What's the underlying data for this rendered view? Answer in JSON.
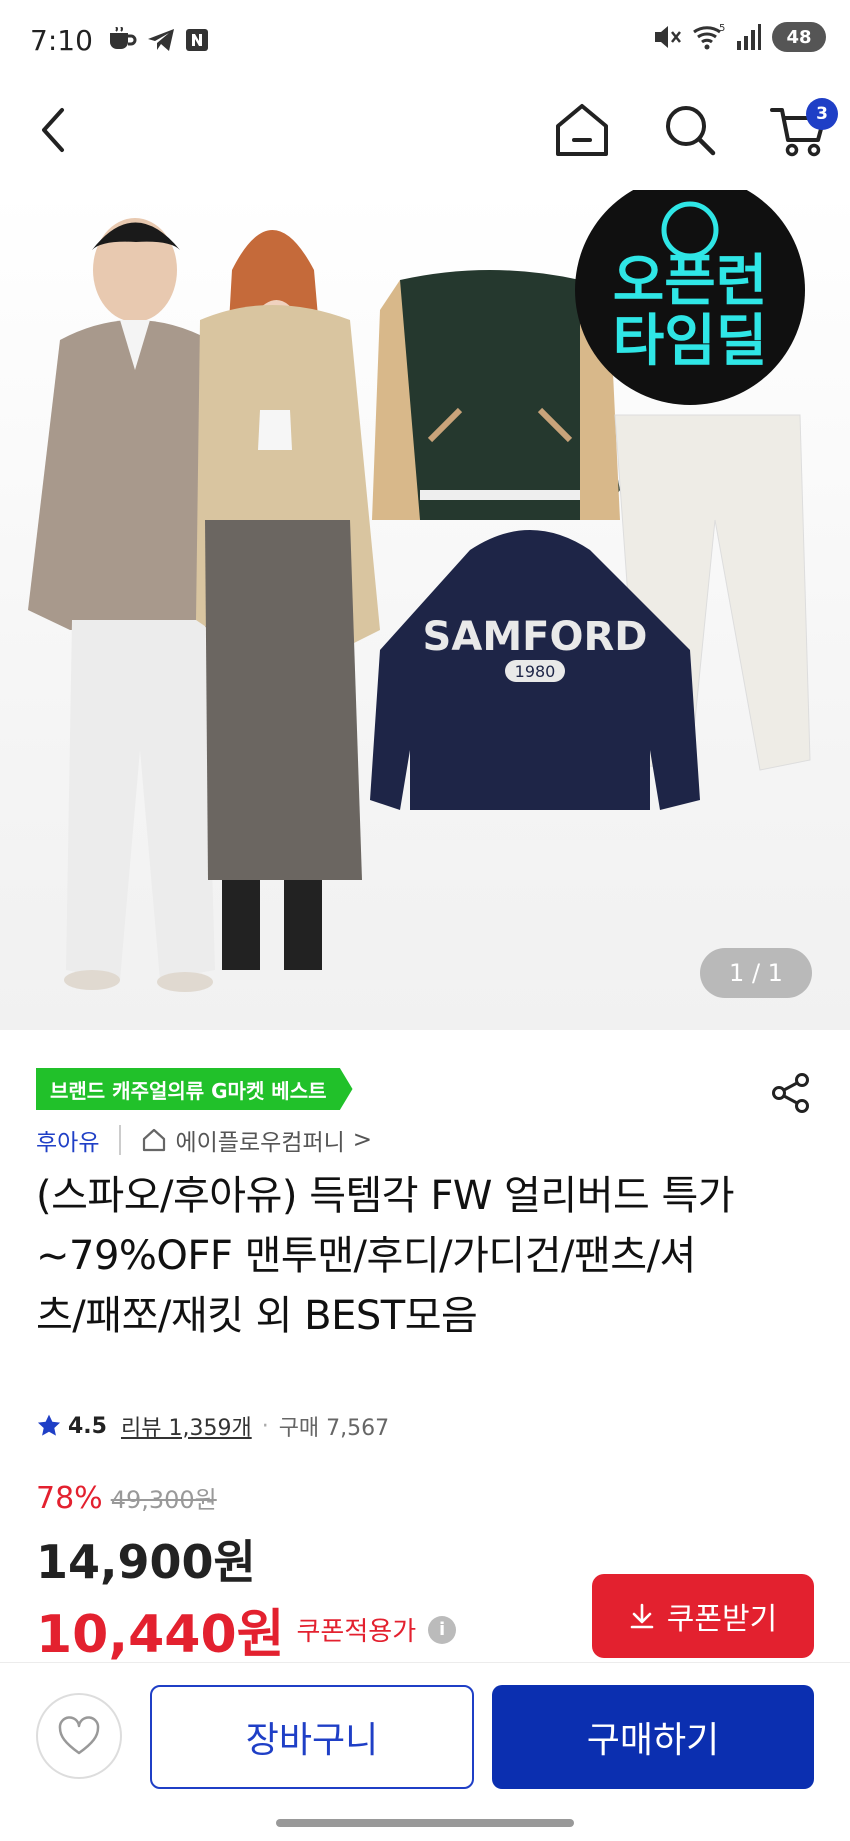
{
  "status_bar": {
    "time": "7:10",
    "left_icons": [
      "coffee-icon",
      "telegram-icon",
      "n-app-icon"
    ],
    "right_icons": [
      "mute-icon",
      "wifi-icon",
      "signal-icon"
    ],
    "wifi_label": "5",
    "battery": "48"
  },
  "nav": {
    "cart_count": "3"
  },
  "hero": {
    "badge_line1": "오픈런",
    "badge_line2": "타임딜",
    "hoodie_text": "SAMFORD",
    "hoodie_sub": "1980",
    "page_indicator": "1 / 1"
  },
  "product": {
    "best_tag": "브랜드 캐주얼의류 G마켓 베스트",
    "brand": "후아유",
    "store": "에이플로우컴퍼니",
    "store_chevron": ">",
    "title": "(스파오/후아유) 득템각 FW 얼리버드 특가 ~79%OFF 맨투맨/후디/가디건/팬츠/셔츠/패쪼/재킷 외 BEST모음",
    "rating": "4.5",
    "review_label": "리뷰 1,359개",
    "purchase_label": "구매 7,567",
    "discount": "78%",
    "original_price": "49,300원",
    "sale_price": "14,900원",
    "coupon_price": "10,440원",
    "coupon_price_label": "쿠폰적용가",
    "coupon_button": "쿠폰받기"
  },
  "bottom_bar": {
    "cart_button": "장바구니",
    "buy_button": "구매하기"
  },
  "colors": {
    "accent_blue": "#1f3fc6",
    "buy_blue": "#0b2fb0",
    "sale_red": "#e3212f",
    "best_green": "#21c12a"
  }
}
